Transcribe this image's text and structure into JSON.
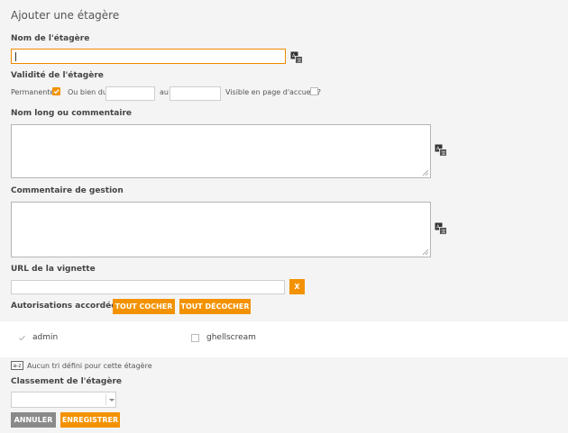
{
  "form": {
    "title": "Ajouter une étagère",
    "name_label": "Nom de l'étagère",
    "name_value": "",
    "validity_label": "Validité de l'étagère",
    "permanent_label": "Permanente",
    "permanent_checked": true,
    "or_from_label": "Ou bien du",
    "to_label": "au",
    "visible_home_label": "Visible en page d'accueil ?",
    "visible_home_checked": false,
    "long_name_label": "Nom long ou commentaire",
    "mgmt_comment_label": "Commentaire de gestion",
    "thumbnail_url_label": "URL de la vignette",
    "thumbnail_clear": "X",
    "permissions_label": "Autorisations accordées à :",
    "check_all": "TOUT COCHER",
    "uncheck_all": "TOUT DÉCOCHER",
    "users": [
      {
        "name": "admin",
        "checked": true,
        "disabled": true
      },
      {
        "name": "ghellscream",
        "checked": false,
        "disabled": false
      }
    ],
    "sort_icon_text": "a-z",
    "sort_text": "Aucun tri défini pour cette étagère",
    "ranking_label": "Classement de l'étagère",
    "ranking_value": "",
    "cancel": "ANNULER",
    "save": "ENREGISTRER"
  },
  "colors": {
    "accent": "#f39200",
    "panel": "#f4f4f4",
    "cancel": "#8a8a8a"
  },
  "icons": {
    "translate": "translate-icon",
    "resize": "resize-grip-icon",
    "sort": "sort-az-icon",
    "dropdown": "chevron-down-icon"
  }
}
